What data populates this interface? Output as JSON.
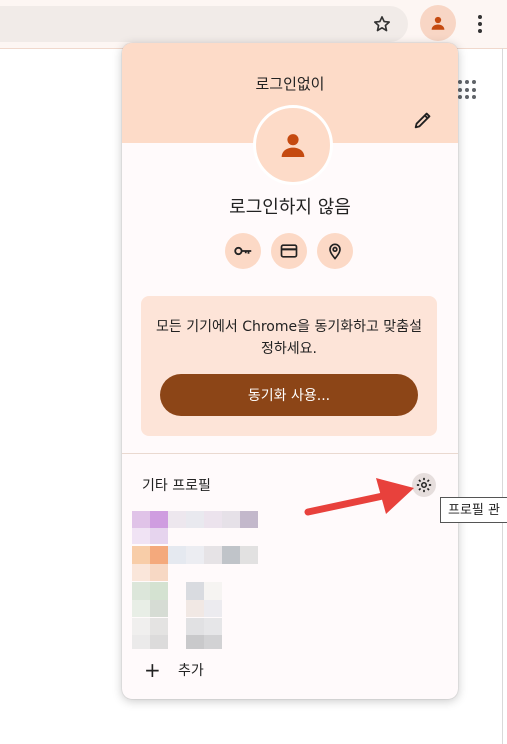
{
  "toolbar": {
    "star_icon": "star-outline-icon",
    "account_icon": "person-icon",
    "menu_icon": "more-vert-icon"
  },
  "popup": {
    "header_label": "로그인없이",
    "status": "로그인하지 않음",
    "quick_actions": [
      {
        "name": "passwords",
        "icon": "key-icon"
      },
      {
        "name": "payment-methods",
        "icon": "credit-card-icon"
      },
      {
        "name": "addresses",
        "icon": "location-pin-icon"
      }
    ],
    "sync": {
      "message": "모든 기기에서 Chrome을 동기화하고 맞춤설정하세요.",
      "button_label": "동기화 사용..."
    },
    "other_profiles": {
      "label": "기타 프로필",
      "add_label": "추가"
    }
  },
  "tooltip": "프로필 관",
  "colors": {
    "accent": "#8c4517",
    "header_bg": "#fddbc8",
    "icon_orange": "#c54a10",
    "arrow_red": "#e8413c"
  }
}
